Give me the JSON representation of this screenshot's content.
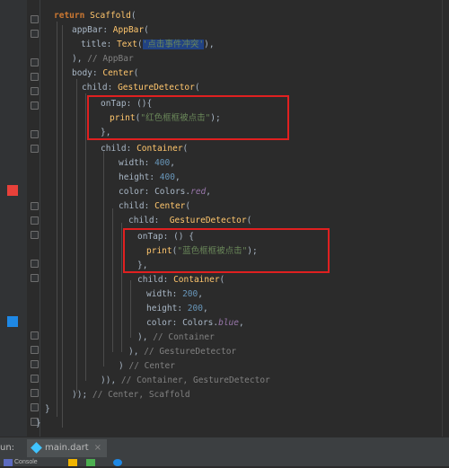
{
  "colors": {
    "red_swatch": "#e8413a",
    "blue_swatch": "#1e88e5",
    "highlight": "#e02020"
  },
  "code": {
    "l1": {
      "kw": "return",
      "cls": "Scaffold",
      "rest": "("
    },
    "l2": {
      "prop": "appBar:",
      "cls": "AppBar",
      "rest": "("
    },
    "l3": {
      "prop": "title:",
      "cls": "Text",
      "open": "(",
      "str": "'点击事件冲突'",
      "close": "),"
    },
    "l4": {
      "text": "),",
      "cm": "// AppBar"
    },
    "l5": {
      "prop": "body:",
      "cls": "Center",
      "rest": "("
    },
    "l6": {
      "prop": "child:",
      "cls": "GestureDetector",
      "rest": "("
    },
    "l7": {
      "prop": "onTap:",
      "rest": "(){"
    },
    "l8": {
      "fn": "print",
      "open": "(",
      "str": "\"红色框框被点击\"",
      "close": ");"
    },
    "l9": {
      "text": "},"
    },
    "l10": {
      "prop": "child:",
      "cls": "Container",
      "rest": "("
    },
    "l11": {
      "prop": "width:",
      "num": "400",
      "rest": ","
    },
    "l12": {
      "prop": "height:",
      "num": "400",
      "rest": ","
    },
    "l13": {
      "prop": "color:",
      "cls": "Colors.",
      "it": "red",
      "rest": ","
    },
    "l14": {
      "prop": "child:",
      "cls": "Center",
      "rest": "("
    },
    "l15": {
      "prop": "child:",
      "cls": "GestureDetector",
      "rest": "("
    },
    "l16": {
      "prop": "onTap:",
      "rest": "() {"
    },
    "l17": {
      "fn": "print",
      "open": "(",
      "str": "\"蓝色框框被点击\"",
      "close": ");"
    },
    "l18": {
      "text": "},"
    },
    "l19": {
      "prop": "child:",
      "cls": "Container",
      "rest": "("
    },
    "l20": {
      "prop": "width:",
      "num": "200",
      "rest": ","
    },
    "l21": {
      "prop": "height:",
      "num": "200",
      "rest": ","
    },
    "l22": {
      "prop": "color:",
      "cls": "Colors.",
      "it": "blue",
      "rest": ","
    },
    "l23": {
      "text": "),",
      "cm": "// Container"
    },
    "l24": {
      "text": "),",
      "cm": "// GestureDetector"
    },
    "l25": {
      "text": ")",
      "cm": "// Center"
    },
    "l26": {
      "text": ")),",
      "cm": "// Container, GestureDetector"
    },
    "l27": {
      "text": "));",
      "cm": "// Center, Scaffold"
    },
    "l28": {
      "text": "}"
    },
    "l29": {
      "text": "}"
    }
  },
  "bottom": {
    "run_label": "un:",
    "file_tab": "main.dart",
    "close": "×",
    "console": "Console"
  }
}
